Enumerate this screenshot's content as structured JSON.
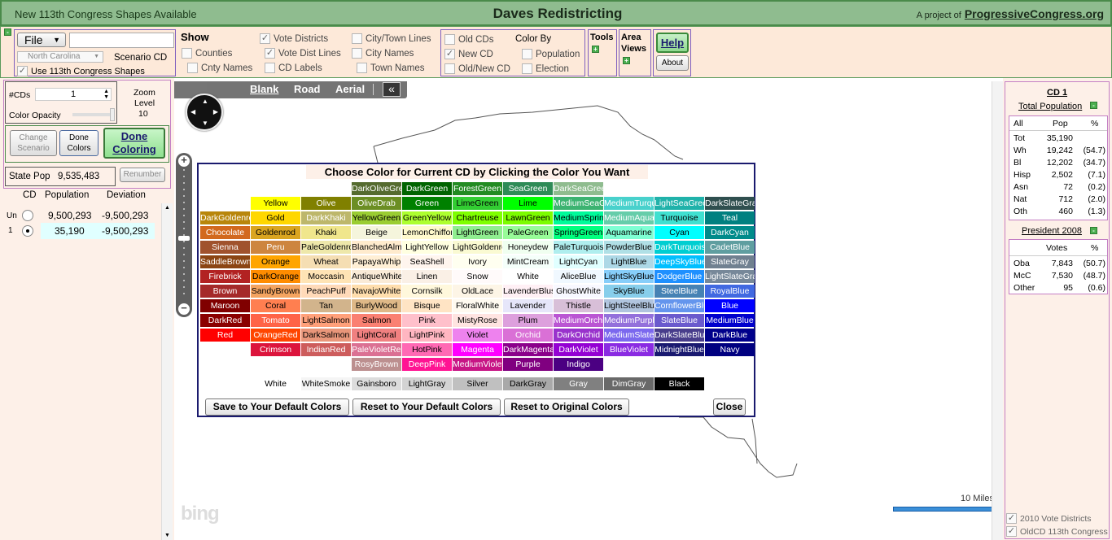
{
  "titlebar": {
    "left": "New 113th Congress Shapes Available",
    "center": "Daves Redistricting",
    "right_prefix": "A project of",
    "right_link": "ProgressiveCongress.org"
  },
  "toolbar": {
    "collapse": "-",
    "file_label": "File",
    "file_input": "",
    "state_select": "North Carolina",
    "scenario_label": "Scenario CD",
    "use_113": "Use 113th Congress Shapes",
    "show_label": "Show",
    "show": {
      "vote_districts": "Vote Districts",
      "counties": "Counties",
      "cnty_names": "Cnty Names",
      "vote_dist_lines": "Vote Dist Lines",
      "cd_labels": "CD Labels",
      "city_town_lines": "City/Town Lines",
      "city_names": "City Names",
      "town_names": "Town Names"
    },
    "cd": {
      "old_cds": "Old CDs",
      "new_cd": "New CD",
      "old_new_cd": "Old/New CD"
    },
    "color_by": {
      "label": "Color By",
      "population": "Population",
      "election": "Election"
    },
    "tools": "Tools",
    "area_views_1": "Area",
    "area_views_2": "Views",
    "plus": "+",
    "help": "Help",
    "about": "About"
  },
  "left": {
    "ncds_label": "#CDs",
    "ncds_value": "1",
    "zoom_label_1": "Zoom",
    "zoom_label_2": "Level",
    "zoom_value": "10",
    "color_opacity": "Color Opacity",
    "change_scenario_1": "Change",
    "change_scenario_2": "Scenario",
    "done_colors_1": "Done",
    "done_colors_2": "Colors",
    "done_coloring_1": "Done",
    "done_coloring_2": "Coloring",
    "state_pop_label": "State Pop",
    "state_pop_value": "9,535,483",
    "renumber": "Renumber",
    "headers": {
      "cd": "CD",
      "population": "Population",
      "deviation": "Deviation"
    },
    "rows": [
      {
        "cd": "Un",
        "population": "9,500,293",
        "deviation": "-9,500,293"
      },
      {
        "cd": "1",
        "population": "35,190",
        "deviation": "-9,500,293"
      }
    ]
  },
  "map": {
    "tabs": [
      "Blank",
      "Road",
      "Aerial"
    ],
    "collapse": "«",
    "scale": "10 Miles",
    "bing": "bing"
  },
  "dialog": {
    "title": "Choose Color for Current CD by Clicking the Color You Want",
    "rows": [
      [
        "",
        "",
        "",
        "DarkOliveGreen",
        "DarkGreen",
        "ForestGreen",
        "SeaGreen",
        "DarkSeaGreen",
        "",
        "",
        "",
        ""
      ],
      [
        "",
        "Yellow",
        "Olive",
        "OliveDrab",
        "Green",
        "LimeGreen",
        "Lime",
        "MediumSeaGreen",
        "MediumTurquoise",
        "LightSeaGreen",
        "DarkSlateGray"
      ],
      [
        "DarkGoldenrod",
        "Gold",
        "DarkKhaki",
        "YellowGreen",
        "GreenYellow",
        "Chartreuse",
        "LawnGreen",
        "MediumSpringGreen",
        "MediumAquamarine",
        "Turquoise",
        "Teal"
      ],
      [
        "Chocolate",
        "Goldenrod",
        "Khaki",
        "Beige",
        "LemonChiffon",
        "LightGreen",
        "PaleGreen",
        "SpringGreen",
        "Aquamarine",
        "Cyan",
        "DarkCyan"
      ],
      [
        "Sienna",
        "Peru",
        "PaleGoldenrod",
        "BlanchedAlmond",
        "LightYellow",
        "LightGoldenrodYellow",
        "Honeydew",
        "PaleTurquoise",
        "PowderBlue",
        "DarkTurquoise",
        "CadetBlue"
      ],
      [
        "SaddleBrown",
        "Orange",
        "Wheat",
        "PapayaWhip",
        "SeaShell",
        "Ivory",
        "MintCream",
        "LightCyan",
        "LightBlue",
        "DeepSkyBlue",
        "SlateGray"
      ],
      [
        "Firebrick",
        "DarkOrange",
        "Moccasin",
        "AntiqueWhite",
        "Linen",
        "Snow",
        "White",
        "AliceBlue",
        "LightSkyBlue",
        "DodgerBlue",
        "LightSlateGray"
      ],
      [
        "Brown",
        "SandyBrown",
        "PeachPuff",
        "NavajoWhite",
        "Cornsilk",
        "OldLace",
        "LavenderBlush",
        "GhostWhite",
        "SkyBlue",
        "SteelBlue",
        "RoyalBlue"
      ],
      [
        "Maroon",
        "Coral",
        "Tan",
        "BurlyWood",
        "Bisque",
        "FloralWhite",
        "Lavender",
        "Thistle",
        "LightSteelBlue",
        "CornflowerBlue",
        "Blue"
      ],
      [
        "DarkRed",
        "Tomato",
        "LightSalmon",
        "Salmon",
        "Pink",
        "MistyRose",
        "Plum",
        "MediumOrchid",
        "MediumPurple",
        "SlateBlue",
        "MediumBlue"
      ],
      [
        "Red",
        "OrangeRed",
        "DarkSalmon",
        "LightCoral",
        "LightPink",
        "Violet",
        "Orchid",
        "DarkOrchid",
        "MediumSlateBlue",
        "DarkSlateBlue",
        "DarkBlue"
      ],
      [
        "",
        "Crimson",
        "IndianRed",
        "PaleVioletRed",
        "HotPink",
        "Magenta",
        "DarkMagenta",
        "DarkViolet",
        "BlueViolet",
        "MidnightBlue",
        "Navy"
      ],
      [
        "",
        "",
        "",
        "RosyBrown",
        "DeepPink",
        "MediumVioletRed",
        "Purple",
        "Indigo",
        "",
        "",
        ""
      ]
    ],
    "grays": [
      "White",
      "WhiteSmoke",
      "Gainsboro",
      "LightGray",
      "Silver",
      "DarkGray",
      "Gray",
      "DimGray",
      "Black"
    ],
    "buttons": {
      "save": "Save to Your Default Colors",
      "reset_default": "Reset to Your Default Colors",
      "reset_original": "Reset to Original Colors",
      "close": "Close"
    }
  },
  "right": {
    "title": "CD 1",
    "total_population": "Total Population",
    "pop_headers": {
      "all": "All",
      "pop": "Pop",
      "pct": "%"
    },
    "pop_rows": [
      {
        "label": "Tot",
        "value": "35,190",
        "pct": ""
      },
      {
        "label": "Wh",
        "value": "19,242",
        "pct": "(54.7)"
      },
      {
        "label": "Bl",
        "value": "12,202",
        "pct": "(34.7)"
      },
      {
        "label": "Hisp",
        "value": "2,502",
        "pct": "(7.1)"
      },
      {
        "label": "Asn",
        "value": "72",
        "pct": "(0.2)"
      },
      {
        "label": "Nat",
        "value": "712",
        "pct": "(2.0)"
      },
      {
        "label": "Oth",
        "value": "460",
        "pct": "(1.3)"
      }
    ],
    "president": "President 2008",
    "vote_headers": {
      "votes": "Votes",
      "pct": "%"
    },
    "vote_rows": [
      {
        "label": "Oba",
        "value": "7,843",
        "pct": "(50.7)"
      },
      {
        "label": "McC",
        "value": "7,530",
        "pct": "(48.7)"
      },
      {
        "label": "Other",
        "value": "95",
        "pct": "(0.6)"
      }
    ],
    "vote_districts_2010": "2010 Vote Districts",
    "oldcd_113": "OldCD 113th Congress"
  }
}
